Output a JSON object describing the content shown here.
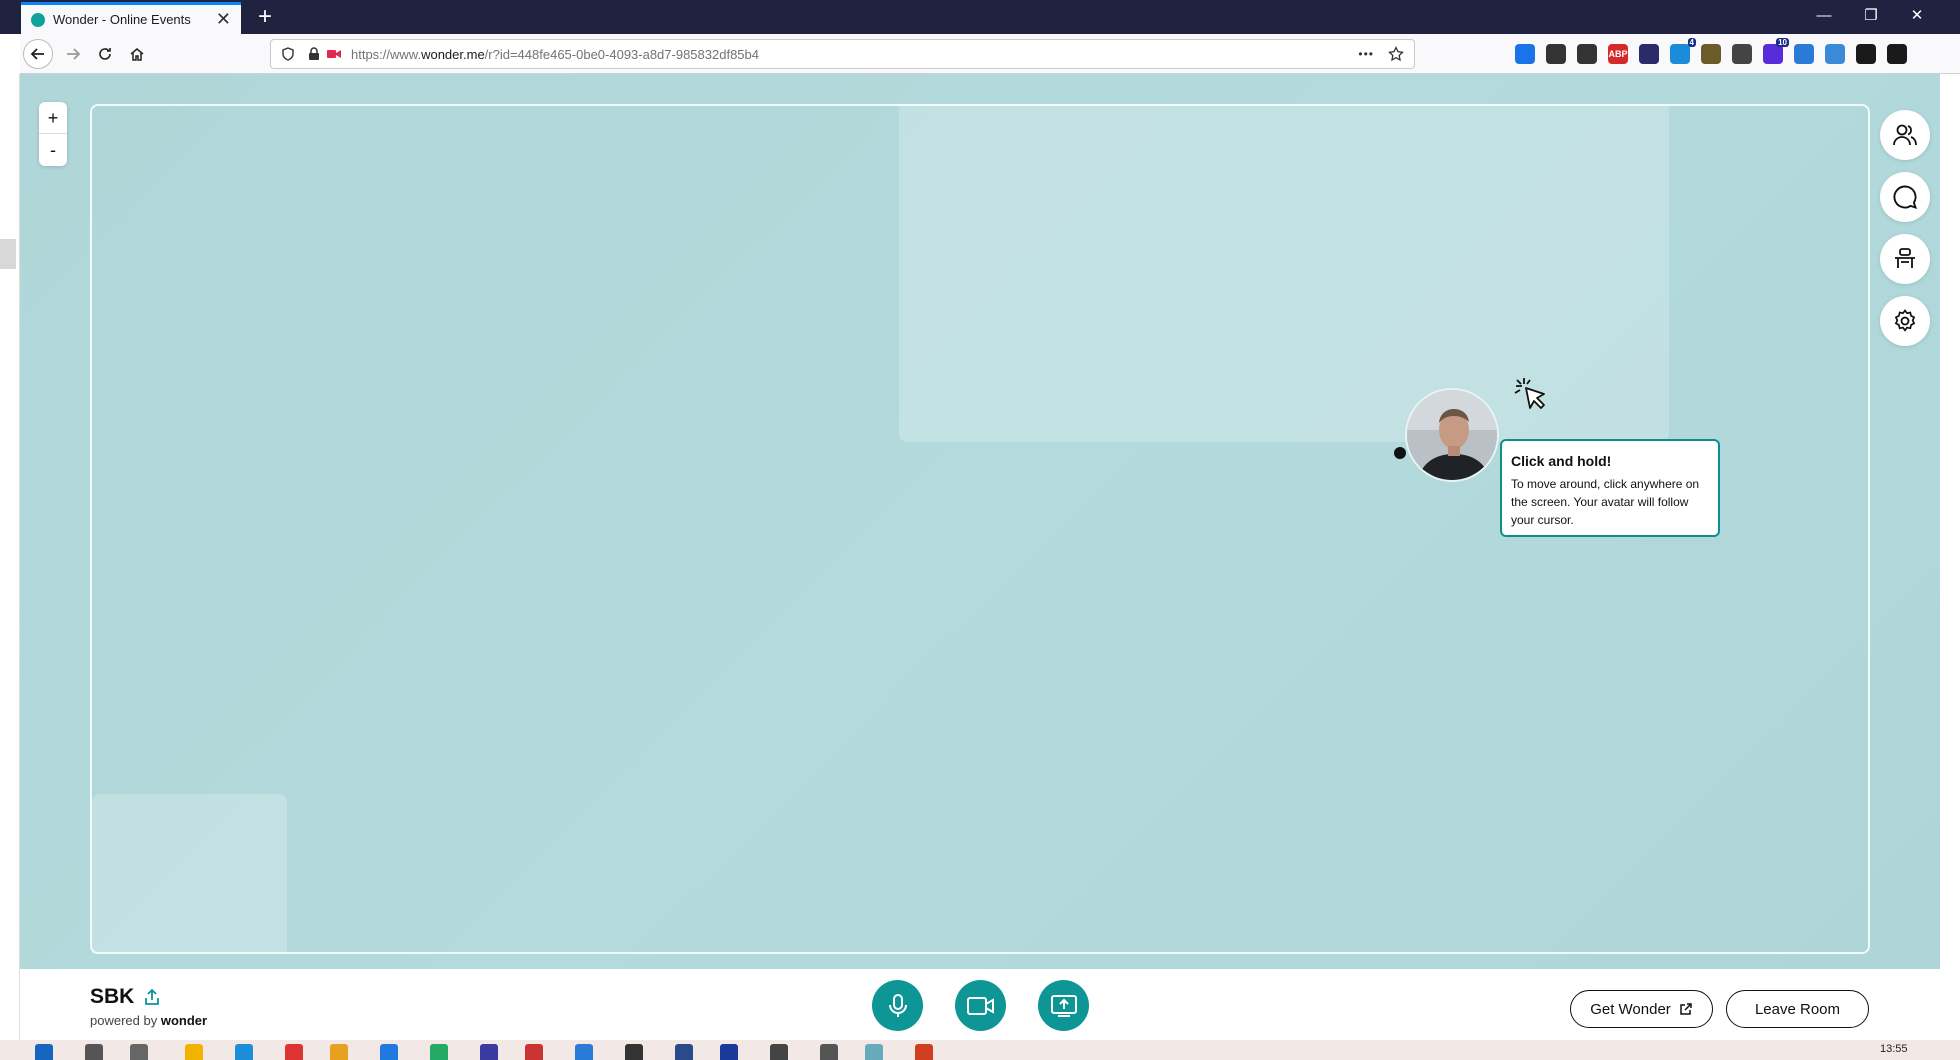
{
  "browser": {
    "tab_title": "Wonder - Online Events",
    "tab_close": "✕",
    "new_tab": "+",
    "url_prefix": "https://www.",
    "url_host": "wonder.me",
    "url_path": "/r?id=448fe465-0be0-4093-a8d7-985832df85b4",
    "url_more": "•••",
    "window_controls": {
      "minimize": "—",
      "restore": "❐",
      "close": "✕"
    },
    "extensions": [
      {
        "name": "download-icon",
        "color": "#1a73e8"
      },
      {
        "name": "library-icon",
        "color": "#333333"
      },
      {
        "name": "reader-icon",
        "color": "#333333"
      },
      {
        "name": "adblock-icon",
        "color": "#d42a2a",
        "label": "ABP"
      },
      {
        "name": "privacy-icon",
        "color": "#2b2b6b"
      },
      {
        "name": "extension-blue-icon",
        "color": "#1a8cd8",
        "badge": "4"
      },
      {
        "name": "extension-tools-icon",
        "color": "#6b5a2a"
      },
      {
        "name": "extension-globe-icon",
        "color": "#444444"
      },
      {
        "name": "extension-purple-icon",
        "color": "#5a2bd8",
        "badge": "10"
      },
      {
        "name": "extension-sync-icon",
        "color": "#2a7bd8"
      },
      {
        "name": "extension-screen-icon",
        "color": "#3a8ad8"
      },
      {
        "name": "extensions-puzzle-icon",
        "color": "#1a1a1a"
      },
      {
        "name": "menu-icon",
        "color": "#1a1a1a"
      }
    ]
  },
  "room": {
    "zoom_in": "+",
    "zoom_out": "-",
    "tooltip": {
      "title": "Click and hold!",
      "body": "To move around, click anywhere on the screen. Your avatar will follow your cursor."
    }
  },
  "footer": {
    "room_name": "SBK",
    "powered_prefix": "powered by ",
    "powered_brand": "wonder",
    "get_wonder": "Get Wonder",
    "leave_room": "Leave Room"
  },
  "taskbar": {
    "clock": "13:55"
  },
  "colors": {
    "accent": "#0e9596",
    "room_bg": "#b0d8da",
    "titlebar": "#202340"
  }
}
